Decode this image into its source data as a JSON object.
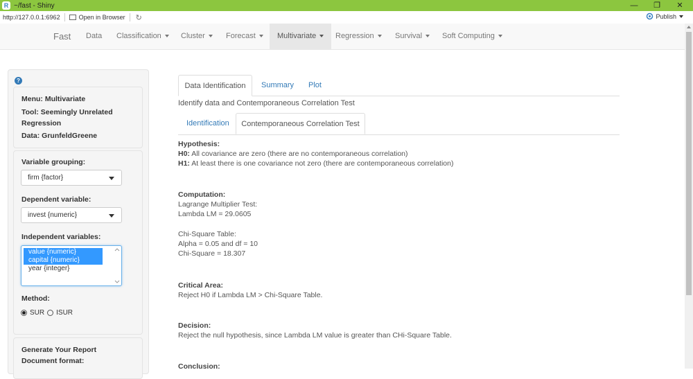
{
  "window": {
    "title": "~/fast - Shiny",
    "app_icon": "rstudio-icon",
    "minimize": "—",
    "maximize": "❐",
    "close": "✕"
  },
  "addressbar": {
    "url": "http://127.0.0.1:6962",
    "open_in_browser": "Open in Browser",
    "publish": "Publish"
  },
  "navbar": {
    "brand": "Fast",
    "items": [
      {
        "label": "Data",
        "dropdown": false
      },
      {
        "label": "Classification",
        "dropdown": true
      },
      {
        "label": "Cluster",
        "dropdown": true
      },
      {
        "label": "Forecast",
        "dropdown": true
      },
      {
        "label": "Multivariate",
        "dropdown": true,
        "active": true
      },
      {
        "label": "Regression",
        "dropdown": true
      },
      {
        "label": "Survival",
        "dropdown": true
      },
      {
        "label": "Soft Computing",
        "dropdown": true
      }
    ]
  },
  "sidebar": {
    "info": {
      "menu": "Menu: Multivariate",
      "tool_line1": "Tool: Seemingly Unrelated",
      "tool_line2": "Regression",
      "data": "Data: GrunfeldGreene"
    },
    "variable_grouping": {
      "label": "Variable grouping:",
      "value": "firm {factor}"
    },
    "dependent_variable": {
      "label": "Dependent variable:",
      "value": "invest {numeric}"
    },
    "independent_variables": {
      "label": "Independent variables:",
      "options": [
        {
          "label": "value {numeric}",
          "selected": true
        },
        {
          "label": "capital {numeric}",
          "selected": true
        },
        {
          "label": "year {integer}",
          "selected": false
        }
      ]
    },
    "method": {
      "label": "Method:",
      "options": [
        {
          "label": "SUR",
          "checked": true
        },
        {
          "label": "ISUR",
          "checked": false
        }
      ]
    },
    "report": {
      "title": "Generate Your Report",
      "format_label": "Document format:"
    }
  },
  "main": {
    "tabs": [
      {
        "label": "Data Identification",
        "active": true
      },
      {
        "label": "Summary"
      },
      {
        "label": "Plot"
      }
    ],
    "description": "Identify data and Contemporaneous Correlation Test",
    "subtabs": [
      {
        "label": "Identification"
      },
      {
        "label": "Contemporaneous Correlation Test",
        "active": true
      }
    ],
    "content": {
      "hypothesis_title": "Hypothesis:",
      "h0_label": "H0:",
      "h0_text": " All covariance are zero (there are no contemporaneous correlation)",
      "h1_label": "H1:",
      "h1_text": " At least there is one covariance not zero (there are contemporaneous correlation)",
      "computation_title": "Computation:",
      "lm_test": "Lagrange Multiplier Test:",
      "lambda_lm": "Lambda LM = 29.0605",
      "chi_table": "Chi-Square Table:",
      "alpha_df": "Alpha = 0.05 and df = 10",
      "chi_square": "Chi-Square = 18.307",
      "critical_title": "Critical Area:",
      "critical_text": "Reject H0 if Lambda LM > Chi-Square Table.",
      "decision_title": "Decision:",
      "decision_text": "Reject the null hypothesis, since Lambda LM value is greater than CHi-Square Table.",
      "conclusion_title": "Conclusion:"
    }
  }
}
